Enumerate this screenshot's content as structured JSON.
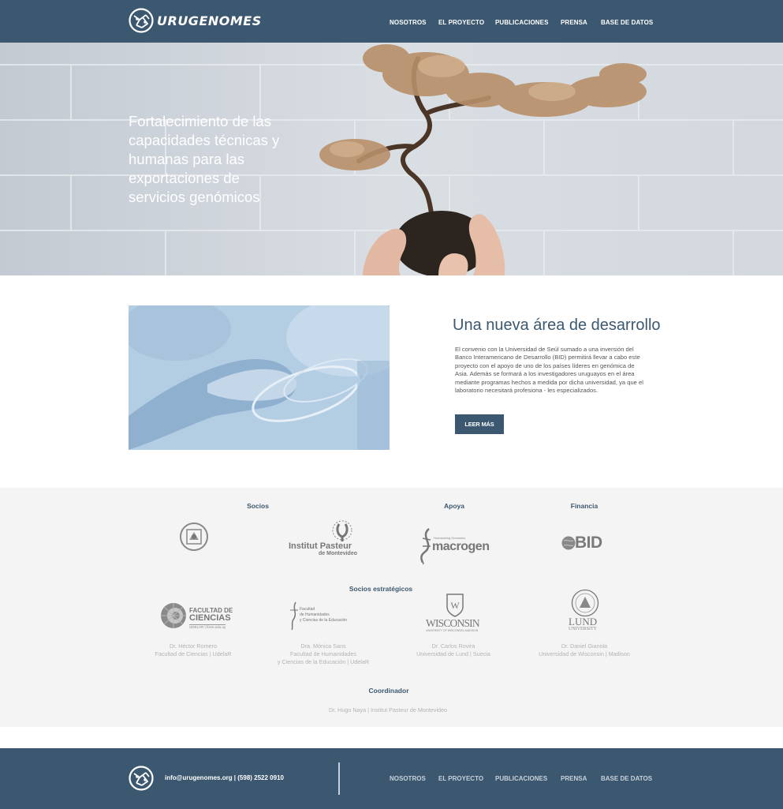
{
  "brand": {
    "name": "URUGENOMES"
  },
  "nav": {
    "items": [
      {
        "label": "NOSOTROS"
      },
      {
        "label": "EL PROYECTO"
      },
      {
        "label": "PUBLICACIONES"
      },
      {
        "label": "PRENSA"
      },
      {
        "label": "BASE DE DATOS"
      }
    ]
  },
  "hero": {
    "title": "Fortalecimiento de las capacidades técnicas y humanas para las exportaciones de servicios genómicos"
  },
  "feature": {
    "title": "Una nueva área de desarrollo",
    "body": "El convenio con la Universidad de Seúl sumado a una inversión del Banco Interamericano de Desarrollo (BID) permitirá llevar a cabo este proyecto con el apoyo de uno de los países líderes en genómica de Asia. Además se formará a los investigadores uruguayos en el área mediante programas hechos a medida por dicha universidad, ya que el laboratorio necesitará profesiona - les especializados.",
    "button": "LEER MÁS"
  },
  "partners": {
    "socios_heading": "Socios",
    "apoya_heading": "Apoya",
    "financia_heading": "Financia",
    "logos_row1": [
      {
        "name": "seoul-university-seal"
      },
      {
        "name": "Institut Pasteur de Montevideo",
        "line1": "Institut Pasteur",
        "line2": "de Montevideo"
      },
      {
        "name": "macrogen",
        "small": "Humanizing Genomics",
        "text": "macrogen"
      },
      {
        "name": "BID",
        "text": "BID"
      }
    ],
    "estrategicos_heading": "Socios estratégicos",
    "logos_row2": [
      {
        "line1": "FACULTAD DE",
        "line2": "CIENCIAS",
        "line3": "UDELAR | fcien.edu.uy"
      },
      {
        "line1": "Facultad",
        "line2": "de Humanidades",
        "line3": "y Ciencias de la Educación"
      },
      {
        "text": "WISCONSIN",
        "small": "UNIVERSITY OF WISCONSIN–MADISON"
      },
      {
        "line1": "LUND",
        "line2": "UNIVERSITY"
      }
    ],
    "people": [
      {
        "name": "Dr. Héctor Romero",
        "line2": "Facultad de Ciencias   |  UdelaR"
      },
      {
        "name": "Dra. Mónica Sans",
        "line2": "Facultad de Humanidades",
        "line3": "y Ciencias de la Educación    |  UdelaR"
      },
      {
        "name": "Dr. Carlos Rovira",
        "line2": "Universidad de Lund   |  Suecia"
      },
      {
        "name": "Dr. Daniel Gianola",
        "line2": "Universidad de Wisconsin    |  Madison"
      }
    ],
    "coordinador_heading": "Coordinador",
    "coordinador": "Dr. Hugo Naya   |  Institut Pasteur de Montevideo"
  },
  "footer": {
    "contact": "info@urugenomes.org     |  (598) 2522 0910",
    "nav": [
      "NOSOTROS",
      "EL PROYECTO",
      "PUBLICACIONES",
      "PRENSA",
      "BASE DE DATOS"
    ]
  },
  "colors": {
    "primary": "#3b5870",
    "light_gray": "#f4f4f4",
    "caption": "#b3b3b3"
  }
}
